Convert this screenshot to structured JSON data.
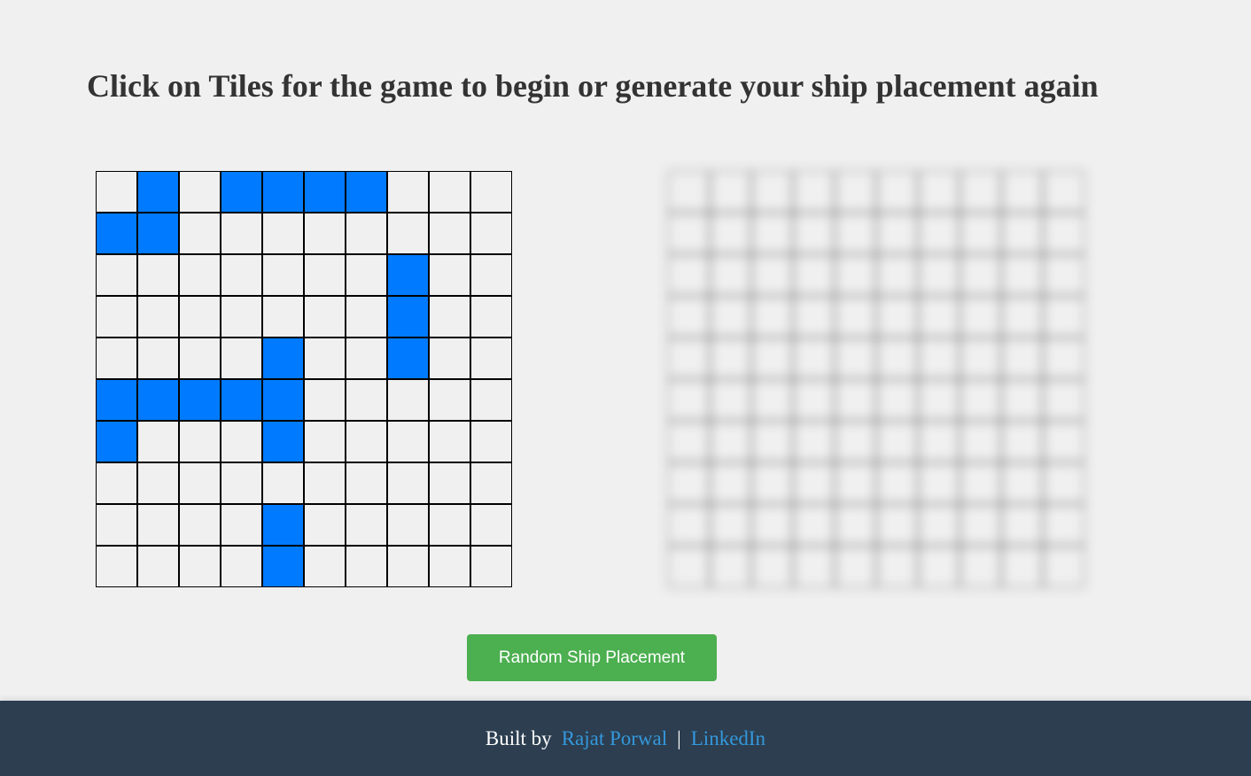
{
  "heading": "Click on Tiles for the game to begin or generate your ship placement again",
  "player_board": {
    "rows": 10,
    "cols": 10,
    "ship_cells": [
      [
        0,
        1
      ],
      [
        0,
        3
      ],
      [
        0,
        4
      ],
      [
        0,
        5
      ],
      [
        0,
        6
      ],
      [
        1,
        0
      ],
      [
        1,
        1
      ],
      [
        2,
        7
      ],
      [
        3,
        7
      ],
      [
        4,
        4
      ],
      [
        4,
        7
      ],
      [
        5,
        0
      ],
      [
        5,
        1
      ],
      [
        5,
        2
      ],
      [
        5,
        3
      ],
      [
        5,
        4
      ],
      [
        6,
        0
      ],
      [
        6,
        4
      ],
      [
        8,
        4
      ],
      [
        9,
        4
      ]
    ]
  },
  "enemy_board": {
    "rows": 10,
    "cols": 10,
    "blurred": true
  },
  "random_button_label": "Random Ship Placement",
  "footer": {
    "built_by": "Built by",
    "author_link": "Rajat Porwal",
    "separator": "|",
    "linkedin_link": "LinkedIn"
  },
  "colors": {
    "ship": "#007bff",
    "tile": "#f0f0f0",
    "button": "#4caf50",
    "footer_bg": "#2c3e50",
    "link": "#3498db"
  }
}
